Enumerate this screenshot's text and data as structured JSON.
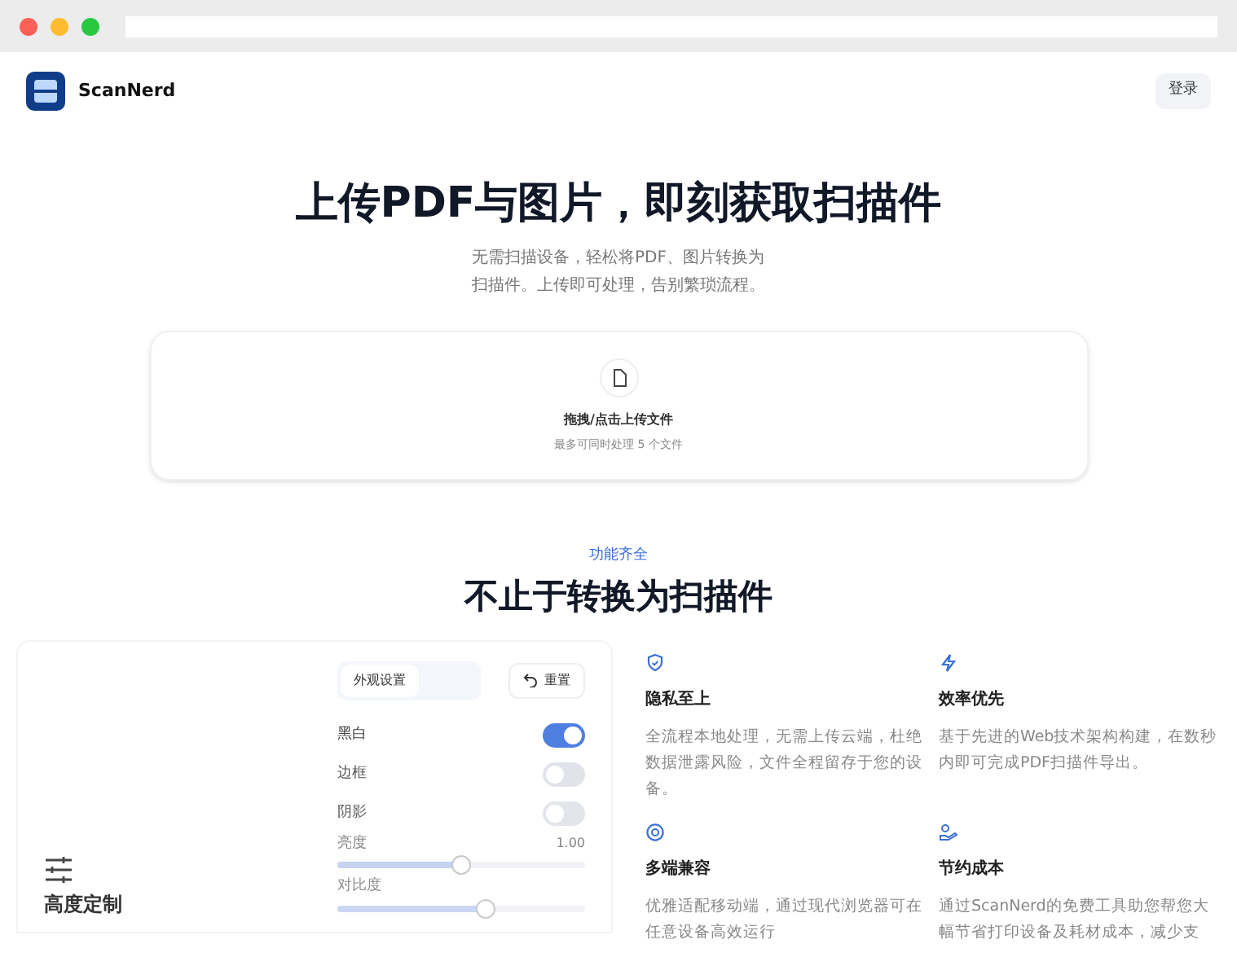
{
  "brand": {
    "name": "ScanNerd"
  },
  "login_button": "登录",
  "hero": {
    "title": "上传PDF与图片，即刻获取扫描件",
    "subtitle_lines": [
      "无需扫描设备，轻松将PDF、图片转换为",
      "扫描件。上传即可处理，告别繁琐流程。"
    ]
  },
  "upload": {
    "label": "拖拽/点击上传文件",
    "hint": "最多可同时处理 5 个文件"
  },
  "features_section": {
    "eyebrow": "功能齐全",
    "heading": "不止于转换为扫描件"
  },
  "customize_card": {
    "title": "高度定制",
    "tabs": [
      {
        "label": "外观设置",
        "selected": true
      }
    ],
    "reset_button": "重置",
    "settings": [
      {
        "kind": "toggle",
        "label": "黑白",
        "on": true
      },
      {
        "kind": "toggle",
        "label": "边框",
        "on": false
      },
      {
        "kind": "toggle",
        "label": "阴影",
        "on": false
      },
      {
        "kind": "slider",
        "label": "亮度",
        "reading": "1.00",
        "level": 0.5
      },
      {
        "kind": "slider",
        "label": "对比度",
        "level": 0.6
      }
    ]
  },
  "features": [
    {
      "title": "隐私至上",
      "text": "全流程本地处理，无需上传云端，杜绝数据泄露风险，文件全程留存于您的设备。"
    },
    {
      "title": "效率优先",
      "text": "基于先进的Web技术架构构建，在数秒内即可完成PDF扫描件导出。"
    },
    {
      "title": "多端兼容",
      "text": "优雅适配移动端，通过现代浏览器可在任意设备高效运行"
    },
    {
      "title": "节约成本",
      "text": "通过ScanNerd的免费工具助您帮您大幅节省打印设备及耗材成本，减少支"
    }
  ]
}
